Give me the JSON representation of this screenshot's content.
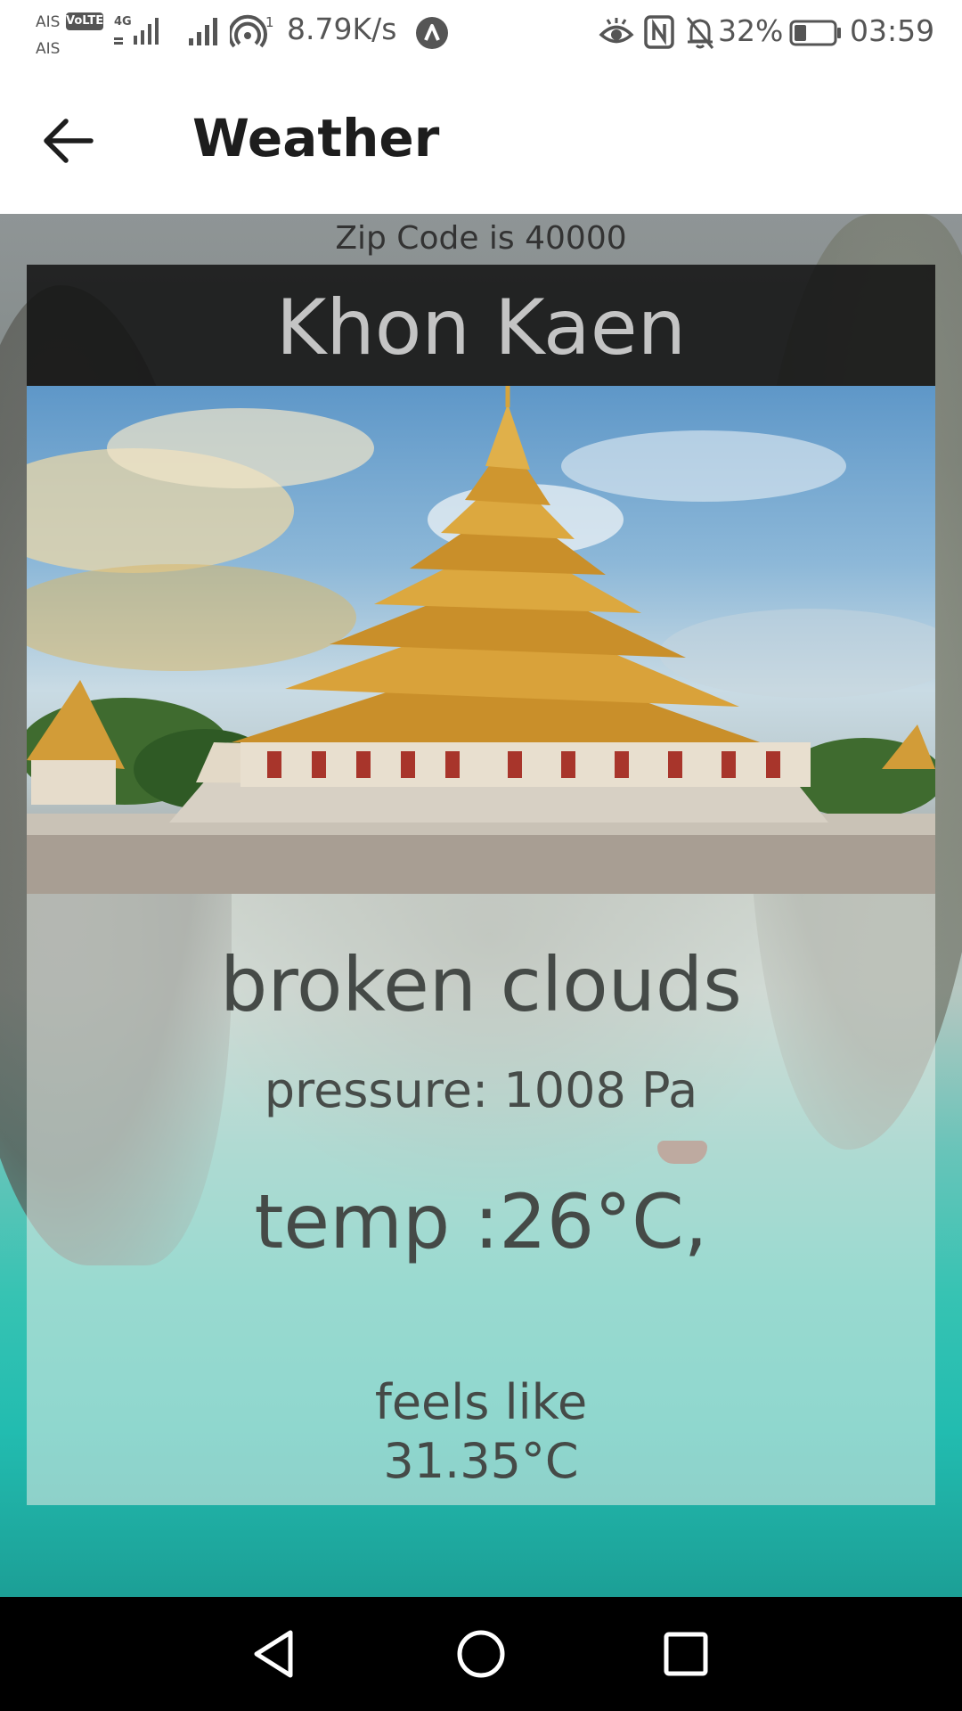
{
  "status_bar": {
    "carrier_1": "AIS",
    "carrier_2": "AIS",
    "volte_badge": "VoLTE",
    "network_type": "4G",
    "hotspot_count": "1",
    "net_speed": "8.79K/s",
    "battery_percent": "32%",
    "battery_level": 0.32,
    "time": "03:59",
    "icons": [
      "signal-bars-icon",
      "hotspot-icon",
      "app-notification-icon",
      "eye-comfort-icon",
      "nfc-icon",
      "bell-off-icon",
      "battery-icon"
    ]
  },
  "app_bar": {
    "title": "Weather",
    "back_icon": "back-arrow-icon"
  },
  "weather": {
    "zip_code_text": "Zip Code is 40000",
    "city": "Khon Kaen",
    "description": "broken clouds",
    "pressure_text": "pressure: 1008 Pa",
    "temp_text": "temp :26°C,",
    "feels_like_label": "feels like",
    "feels_like_value": "31.35°C"
  },
  "nav_bar": {
    "icons": [
      "nav-back-icon",
      "nav-home-icon",
      "nav-recents-icon"
    ]
  },
  "colors": {
    "banner": "#121212",
    "city_text": "#c4c4c4",
    "panel_text": "#454a47",
    "nav_bar": "#000000"
  }
}
